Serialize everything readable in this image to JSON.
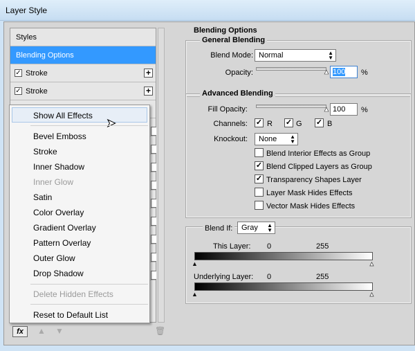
{
  "window": {
    "title": "Layer Style"
  },
  "styles_panel": {
    "rows": [
      {
        "label": "Styles",
        "checked": null
      },
      {
        "label": "Blending Options",
        "checked": null
      },
      {
        "label": "Stroke",
        "checked": true
      },
      {
        "label": "Stroke",
        "checked": true
      }
    ],
    "fx_label": "fx",
    "icons": {
      "up": "arrow-up-icon",
      "down": "arrow-down-icon",
      "trash": "trash-icon"
    }
  },
  "context_menu": {
    "items": [
      {
        "label": "Show All Effects",
        "disabled": false,
        "highlighted": true
      },
      {
        "label": "Bevel  Emboss",
        "disabled": false
      },
      {
        "label": "Stroke",
        "disabled": false
      },
      {
        "label": "Inner Shadow",
        "disabled": false
      },
      {
        "label": "Inner Glow",
        "disabled": true
      },
      {
        "label": "Satin",
        "disabled": false
      },
      {
        "label": "Color Overlay",
        "disabled": false
      },
      {
        "label": "Gradient Overlay",
        "disabled": false
      },
      {
        "label": "Pattern Overlay",
        "disabled": false
      },
      {
        "label": "Outer Glow",
        "disabled": false
      },
      {
        "label": "Drop Shadow",
        "disabled": false
      },
      {
        "label": "Delete Hidden Effects",
        "disabled": true
      },
      {
        "label": "Reset to Default List",
        "disabled": false
      }
    ]
  },
  "blending_options": {
    "title": "Blending Options",
    "general": {
      "title": "General Blending",
      "blend_mode_label": "Blend Mode:",
      "blend_mode_value": "Normal",
      "opacity_label": "Opacity:",
      "opacity_value": "100",
      "unit": "%"
    },
    "advanced": {
      "title": "Advanced Blending",
      "fill_opacity_label": "Fill Opacity:",
      "fill_opacity_value": "100",
      "unit": "%",
      "channels_label": "Channels:",
      "channels": [
        "R",
        "G",
        "B"
      ],
      "knockout_label": "Knockout:",
      "knockout_value": "None",
      "options": [
        {
          "label": "Blend Interior Effects as Group",
          "checked": false
        },
        {
          "label": "Blend Clipped Layers as Group",
          "checked": true
        },
        {
          "label": "Transparency Shapes Layer",
          "checked": true
        },
        {
          "label": "Layer Mask Hides Effects",
          "checked": false
        },
        {
          "label": "Vector Mask Hides Effects",
          "checked": false
        }
      ]
    },
    "blend_if": {
      "label": "Blend If:",
      "value": "Gray",
      "this_layer_label": "This Layer:",
      "this_layer_min": "0",
      "this_layer_max": "255",
      "underlying_label": "Underlying Layer:",
      "underlying_min": "0",
      "underlying_max": "255"
    }
  }
}
